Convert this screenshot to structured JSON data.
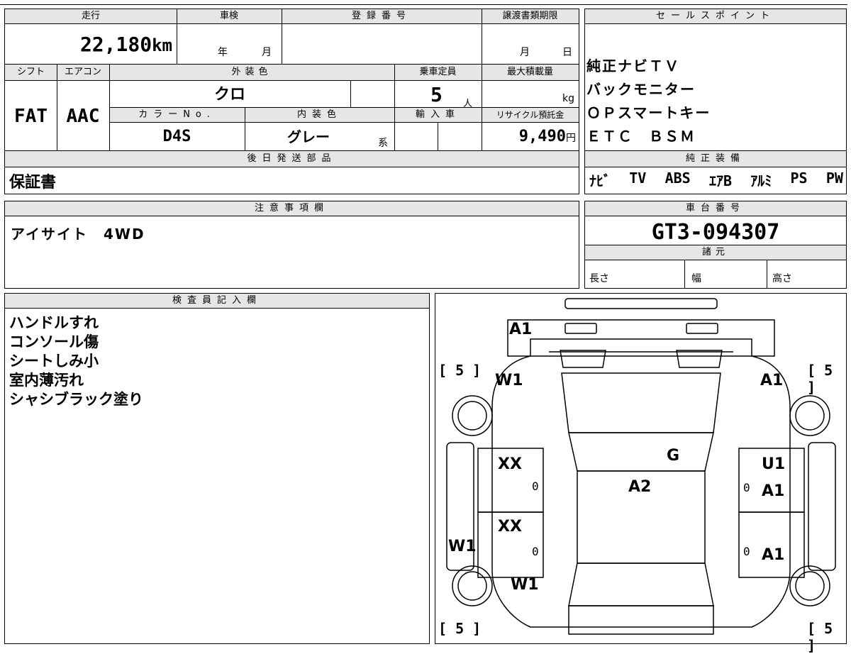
{
  "header": {
    "mileage_label": "走行",
    "inspection_label": "車検",
    "registration_label": "登録番号",
    "transfer_label": "譲渡書類期限",
    "mileage_value": "22,180",
    "mileage_unit": "km",
    "year_label": "年",
    "month_label": "月",
    "transfer_month": "月",
    "transfer_day": "日"
  },
  "specs": {
    "shift_label": "シフト",
    "aircon_label": "エアコン",
    "exterior_label": "外装色",
    "capacity_label": "乗車定員",
    "maxload_label": "最大積載量",
    "shift_value": "FAT",
    "aircon_value": "AAC",
    "exterior_value": "クロ",
    "capacity_value": "5",
    "capacity_unit": "人",
    "maxload_unit": "kg",
    "color_no_label": "カラーNo.",
    "interior_label": "内装色",
    "import_label": "輸入車",
    "recycle_label": "リサイクル預託金",
    "color_no_value": "D4S",
    "interior_value": "グレー",
    "interior_suffix": "系",
    "recycle_value": "9,490",
    "recycle_unit": "円"
  },
  "later": {
    "label": "後日発送部品",
    "value": "保証書"
  },
  "sales": {
    "label": "セールスポイント",
    "lines": [
      "純正ナビＴＶ",
      "バックモニター",
      "ＯＰスマートキー",
      "ＥＴＣ　ＢＳＭ"
    ]
  },
  "equipment": {
    "label": "純正装備",
    "items": [
      "ﾅﾋﾞ",
      "TV",
      "ABS",
      "ｴｱB",
      "ｱﾙﾐ",
      "PS",
      "PW"
    ]
  },
  "notes": {
    "label": "注意事項欄",
    "value": "アイサイト　4WD"
  },
  "chassis": {
    "label": "車台番号",
    "value": "GT3-094307",
    "spec_label": "諸元",
    "length_label": "長さ",
    "width_label": "幅",
    "height_label": "高さ"
  },
  "inspector": {
    "label": "検査員記入欄",
    "lines": [
      "ハンドルすれ",
      "コンソール傷",
      "シートしみ小",
      "室内薄汚れ",
      "シャシブラック塗り"
    ]
  },
  "diagram": {
    "tire_left_top": "[ 5 ]",
    "tire_right_top": "[ 5 ]",
    "tire_left_bottom": "[ 5 ]",
    "tire_right_bottom": "[ 5 ]",
    "front_bumper": "A1",
    "front_left_fender": "W1",
    "front_right_fender": "A1",
    "windshield": "G",
    "left_front_door": "XX",
    "left_front_door_0": "0",
    "left_rear_door": "XX",
    "left_rear_door_0": "0",
    "left_rocker": "W1",
    "rear_left_fender": "W1",
    "roof": "A2",
    "right_front_door_top": "U1",
    "right_front_door": "A1",
    "right_front_door_0": "0",
    "right_rear_door": "A1",
    "right_rear_door_0": "0"
  }
}
